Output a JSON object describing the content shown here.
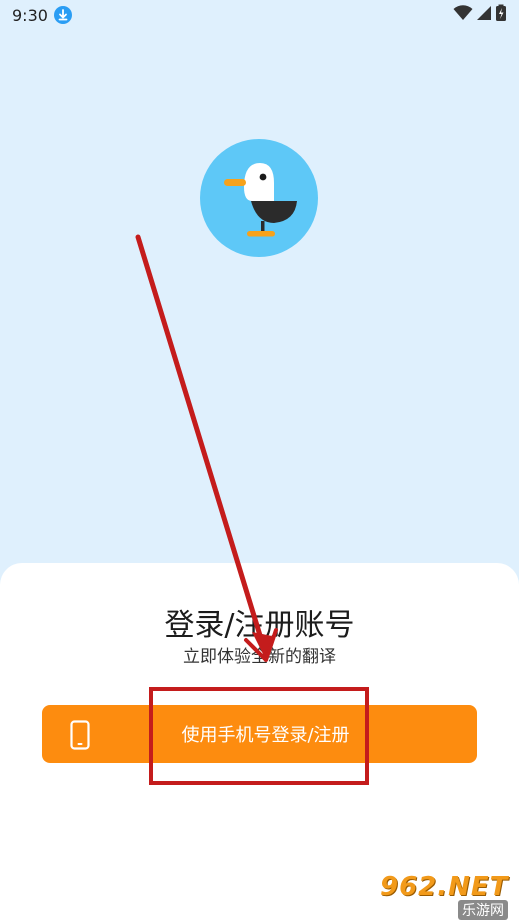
{
  "status_bar": {
    "time": "9:30",
    "icons": [
      "download-icon",
      "wifi-icon",
      "signal-icon",
      "battery-icon"
    ]
  },
  "app": {
    "logo_icon": "seagull-logo-icon",
    "logo_bg_color": "#5ec8f7"
  },
  "login_sheet": {
    "title": "登录/注册账号",
    "subtitle": "立即体验全新的翻译",
    "phone_login_button": "使用手机号登录/注册",
    "button_color": "#fd8c0f",
    "button_icon": "phone-icon"
  },
  "annotation": {
    "arrow_color": "#c41c1c",
    "highlight_color": "#c41c1c"
  },
  "watermark": {
    "top": "962.NET",
    "bottom": "乐游网"
  }
}
